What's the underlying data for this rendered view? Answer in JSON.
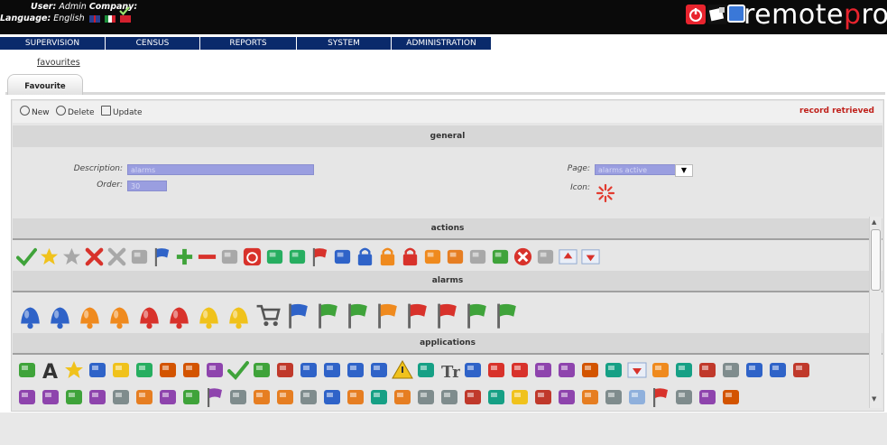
{
  "header": {
    "user_label": "User:",
    "user_value": "Admin",
    "company_label": "Company:",
    "language_label": "Language:",
    "language_value": "English",
    "brand_prefix": "remote",
    "brand_p": "p",
    "brand_suffix": "ro"
  },
  "nav": {
    "tabs": [
      {
        "label": "SUPERVISION"
      },
      {
        "label": "CENSUS"
      },
      {
        "label": "REPORTS"
      },
      {
        "label": "SYSTEM"
      },
      {
        "label": "ADMINISTRATION"
      }
    ]
  },
  "breadcrumb": {
    "favourites_link": "favourites"
  },
  "tab": {
    "label": "Favourite"
  },
  "toolbar": {
    "new_label": "New",
    "delete_label": "Delete",
    "update_label": "Update",
    "status": "record retrieved"
  },
  "sections": {
    "general": "general",
    "actions": "actions",
    "alarms": "alarms",
    "applications": "applications"
  },
  "form": {
    "description_label": "Description:",
    "description_value": "alarms",
    "order_label": "Order:",
    "order_value": "30",
    "page_label": "Page:",
    "page_value": "alarms active",
    "icon_label": "Icon:"
  },
  "colors": {
    "nav_bg": "#0a2a6b",
    "status_red": "#c0211b",
    "field_bg": "#9a9ee0",
    "brand_red": "#e8242e"
  },
  "icons": {
    "actions": [
      "check",
      "star-gold",
      "star-grey",
      "cross-red",
      "cross-grey",
      "clipboard",
      "flag-blue",
      "plus-green",
      "minus-red",
      "clipboard-grey",
      "power-red",
      "binoculars",
      "binoculars",
      "flag-red",
      "disk",
      "lock-blue",
      "lock-orange",
      "lock-red",
      "moon",
      "key",
      "pencil",
      "spell-check",
      "stop-red",
      "magnifier",
      "arrow-up",
      "arrow-down"
    ],
    "alarms": [
      "bell-blue",
      "bell-blue",
      "bell-orange",
      "bell-orange",
      "bell-red",
      "bell-red",
      "bell-yellow",
      "bell-yellow",
      "cart",
      "flag-lightblue",
      "flag-green",
      "flag-green",
      "flag-orange",
      "flag-red",
      "flag-red",
      "flag-lime",
      "flag-lime"
    ],
    "applications_row1": [
      "chart",
      "font-a",
      "star-burst",
      "monitor",
      "bottle",
      "gear-group",
      "network",
      "notepad",
      "wall",
      "check",
      "person-chart",
      "calendar",
      "books",
      "book",
      "monitor-2",
      "globe",
      "warning",
      "window",
      "font-t",
      "globe-2",
      "fire",
      "bomb",
      "atom",
      "cube",
      "drawing",
      "people",
      "arrows",
      "palette",
      "figure",
      "people-2",
      "users",
      "disk",
      "notebook",
      "window-2"
    ],
    "applications_row2": [
      "home",
      "grid",
      "tools",
      "wifi",
      "boxes",
      "doc",
      "bars",
      "chart-2",
      "flag",
      "print",
      "cat",
      "box",
      "graph",
      "globe-3",
      "pin",
      "bubble",
      "cap",
      "doc-2",
      "doc-3",
      "window-3",
      "folder",
      "bulb",
      "figure-2",
      "city",
      "car",
      "cards",
      "cloud",
      "flag-us",
      "car-2",
      "card",
      "ellipse"
    ]
  }
}
